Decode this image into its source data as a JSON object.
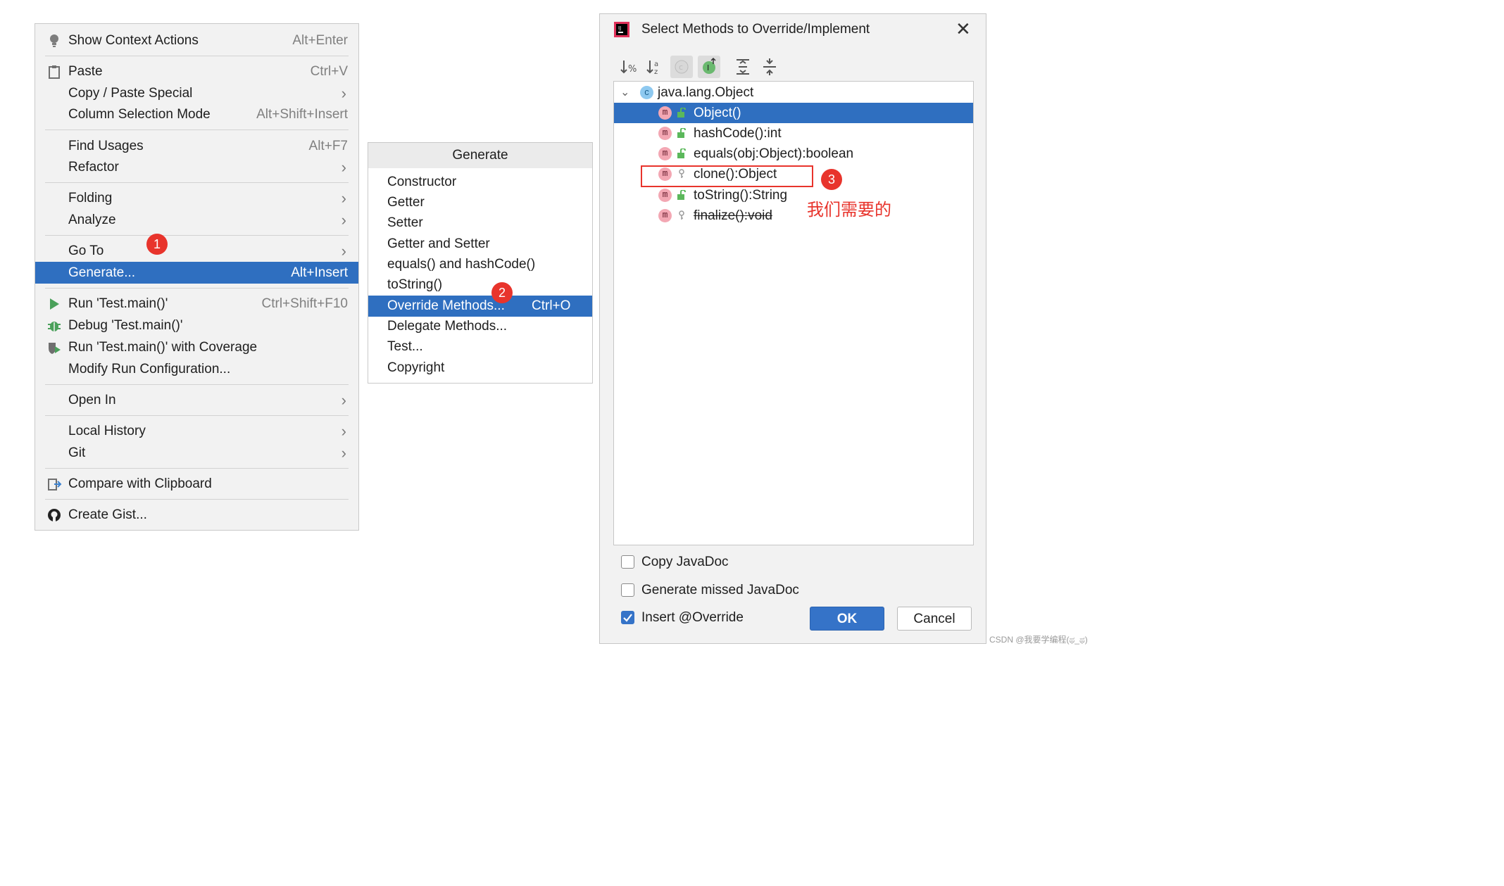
{
  "context_menu": {
    "items": [
      {
        "label": "Show Context Actions",
        "shortcut": "Alt+Enter"
      },
      {
        "label": "Paste",
        "shortcut": "Ctrl+V"
      },
      {
        "label": "Copy / Paste Special"
      },
      {
        "label": "Column Selection Mode",
        "shortcut": "Alt+Shift+Insert"
      },
      {
        "label": "Find Usages",
        "shortcut": "Alt+F7"
      },
      {
        "label": "Refactor"
      },
      {
        "label": "Folding"
      },
      {
        "label": "Analyze"
      },
      {
        "label": "Go To"
      },
      {
        "label": "Generate...",
        "shortcut": "Alt+Insert"
      },
      {
        "label": "Run 'Test.main()'",
        "shortcut": "Ctrl+Shift+F10"
      },
      {
        "label": "Debug 'Test.main()'"
      },
      {
        "label": "Run 'Test.main()' with Coverage"
      },
      {
        "label": "Modify Run Configuration..."
      },
      {
        "label": "Open In"
      },
      {
        "label": "Local History"
      },
      {
        "label": "Git"
      },
      {
        "label": "Compare with Clipboard"
      },
      {
        "label": "Create Gist..."
      }
    ],
    "selected": "Generate..."
  },
  "generate_menu": {
    "title": "Generate",
    "items": [
      {
        "label": "Constructor"
      },
      {
        "label": "Getter"
      },
      {
        "label": "Setter"
      },
      {
        "label": "Getter and Setter"
      },
      {
        "label": "equals() and hashCode()"
      },
      {
        "label": "toString()"
      },
      {
        "label": "Override Methods...",
        "shortcut": "Ctrl+O"
      },
      {
        "label": "Delegate Methods..."
      },
      {
        "label": "Test..."
      },
      {
        "label": "Copyright"
      }
    ],
    "selected": "Override Methods..."
  },
  "dialog": {
    "title": "Select Methods to Override/Implement",
    "tree_root": "java.lang.Object",
    "class_badge": "c",
    "method_badge": "m",
    "methods": [
      {
        "label": "Object()",
        "access": "public",
        "selected": true
      },
      {
        "label": "hashCode():int",
        "access": "public"
      },
      {
        "label": "equals(obj:Object):boolean",
        "access": "public"
      },
      {
        "label": "clone():Object",
        "access": "protected"
      },
      {
        "label": "toString():String",
        "access": "public"
      },
      {
        "label": "finalize():void",
        "access": "protected",
        "deprecated": true
      }
    ],
    "options": [
      {
        "label": "Copy JavaDoc",
        "checked": false
      },
      {
        "label": "Generate missed JavaDoc",
        "checked": false
      },
      {
        "label": "Insert @Override",
        "checked": true
      }
    ],
    "ok_label": "OK",
    "cancel_label": "Cancel",
    "toolbar_icons": [
      "sort-by-visibility-icon",
      "sort-alphabetically-icon",
      "show-classes-icon",
      "show-interfaces-icon",
      "expand-all-icon",
      "collapse-all-icon"
    ]
  },
  "annotations": {
    "step1": "1",
    "step2": "2",
    "step3": "3",
    "note": "我们需要的"
  },
  "watermark": "CSDN @我要学编程(ಥ_ಥ)",
  "colors": {
    "selection": "#2f6fc0",
    "annotation": "#e8342c",
    "ok_button": "#3573c8"
  }
}
